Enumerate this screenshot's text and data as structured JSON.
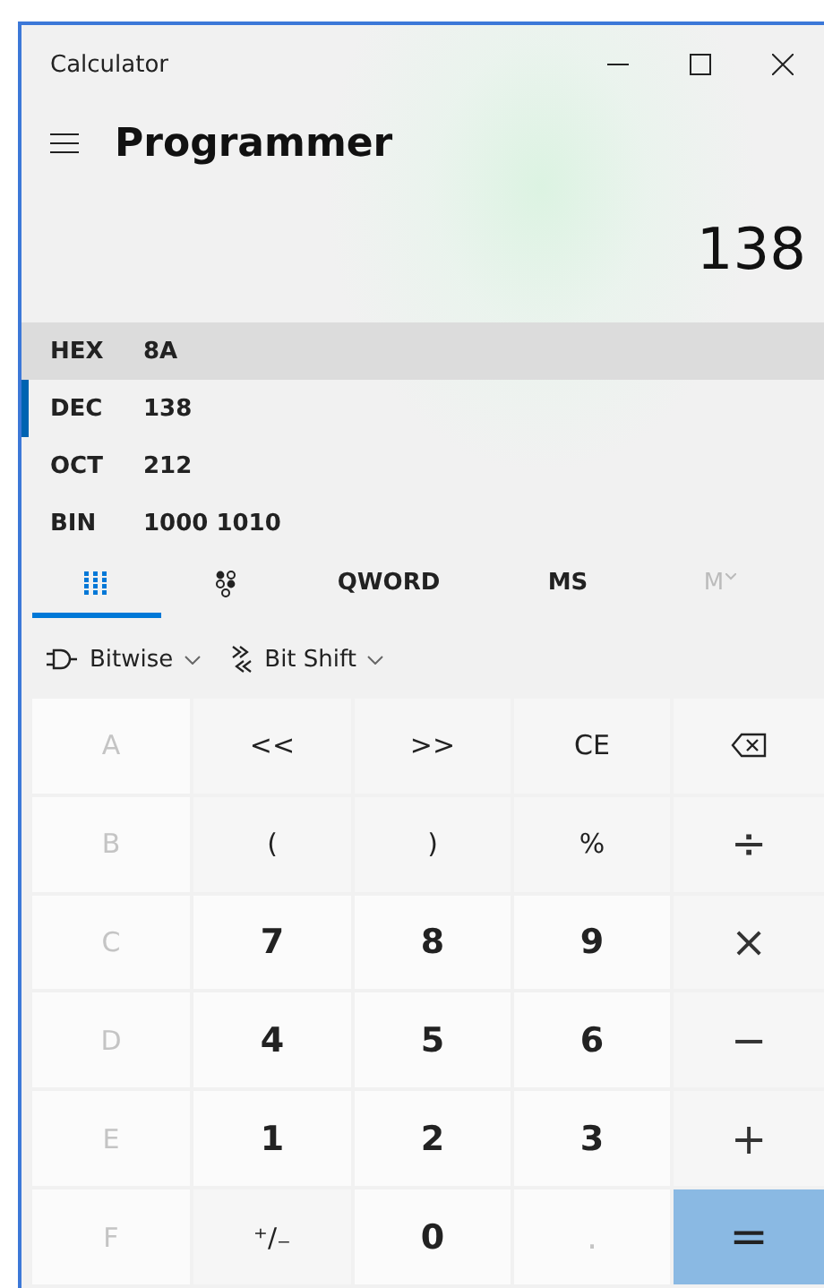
{
  "window": {
    "title": "Calculator"
  },
  "mode": {
    "title": "Programmer"
  },
  "display": {
    "value": "138"
  },
  "radixes": [
    {
      "label": "HEX",
      "value": "8A",
      "selected": false,
      "highlighted": true
    },
    {
      "label": "DEC",
      "value": "138",
      "selected": true,
      "highlighted": false
    },
    {
      "label": "OCT",
      "value": "212",
      "selected": false,
      "highlighted": false
    },
    {
      "label": "BIN",
      "value": "1000 1010",
      "selected": false,
      "highlighted": false
    }
  ],
  "tabs": [
    {
      "kind": "keypad",
      "selected": true,
      "disabled": false
    },
    {
      "kind": "bits",
      "selected": false,
      "disabled": false
    },
    {
      "kind": "text",
      "label": "QWORD",
      "selected": false,
      "disabled": false
    },
    {
      "kind": "text",
      "label": "MS",
      "selected": false,
      "disabled": false
    },
    {
      "kind": "memory",
      "label": "M",
      "selected": false,
      "disabled": true
    }
  ],
  "menus": [
    {
      "kind": "bitwise",
      "label": "Bitwise"
    },
    {
      "kind": "shift",
      "label": "Bit Shift"
    }
  ],
  "keys": [
    {
      "kind": "hex",
      "label": "A",
      "disabled": true
    },
    {
      "kind": "op",
      "label": "<<",
      "disabled": false
    },
    {
      "kind": "op",
      "label": ">>",
      "disabled": false
    },
    {
      "kind": "op",
      "label": "CE",
      "disabled": false
    },
    {
      "kind": "backspace",
      "disabled": false
    },
    {
      "kind": "hex",
      "label": "B",
      "disabled": true
    },
    {
      "kind": "op",
      "label": "(",
      "disabled": false
    },
    {
      "kind": "op",
      "label": ")",
      "disabled": false
    },
    {
      "kind": "op",
      "label": "%",
      "disabled": false
    },
    {
      "kind": "sign",
      "label": "÷",
      "disabled": false
    },
    {
      "kind": "hex",
      "label": "C",
      "disabled": true
    },
    {
      "kind": "digit",
      "label": "7",
      "disabled": false
    },
    {
      "kind": "digit",
      "label": "8",
      "disabled": false
    },
    {
      "kind": "digit",
      "label": "9",
      "disabled": false
    },
    {
      "kind": "sign",
      "label": "×",
      "disabled": false
    },
    {
      "kind": "hex",
      "label": "D",
      "disabled": true
    },
    {
      "kind": "digit",
      "label": "4",
      "disabled": false
    },
    {
      "kind": "digit",
      "label": "5",
      "disabled": false
    },
    {
      "kind": "digit",
      "label": "6",
      "disabled": false
    },
    {
      "kind": "sign",
      "label": "−",
      "disabled": false
    },
    {
      "kind": "hex",
      "label": "E",
      "disabled": true
    },
    {
      "kind": "digit",
      "label": "1",
      "disabled": false
    },
    {
      "kind": "digit",
      "label": "2",
      "disabled": false
    },
    {
      "kind": "digit",
      "label": "3",
      "disabled": false
    },
    {
      "kind": "sign",
      "label": "+",
      "disabled": false
    },
    {
      "kind": "hex",
      "label": "F",
      "disabled": true
    },
    {
      "kind": "op",
      "label": "⁺/₋",
      "disabled": false
    },
    {
      "kind": "digit",
      "label": "0",
      "disabled": false
    },
    {
      "kind": "digit",
      "label": ".",
      "disabled": true
    },
    {
      "kind": "equals",
      "label": "=",
      "disabled": false
    }
  ]
}
